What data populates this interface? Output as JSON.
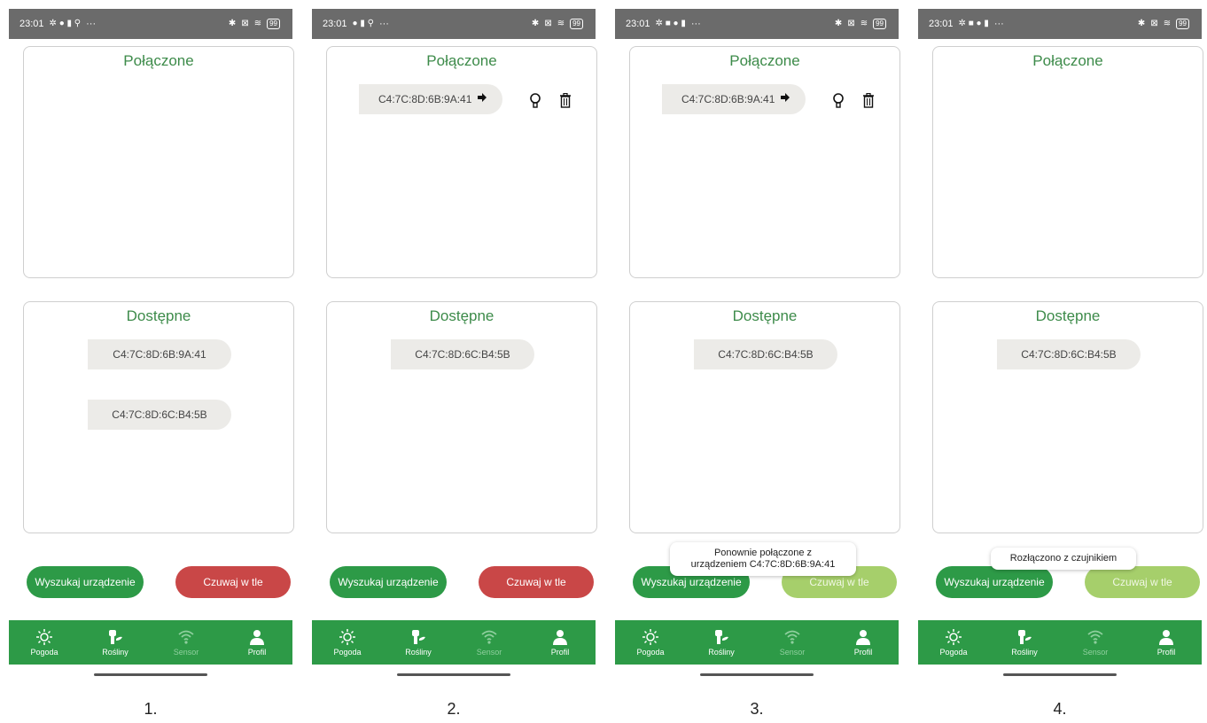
{
  "status_time": "23:01",
  "status_more": "···",
  "battery": "99",
  "section_connected": "Połączone",
  "section_available": "Dostępne",
  "device_a": "C4:7C:8D:6B:9A:41",
  "device_b": "C4:7C:8D:6C:B4:5B",
  "buttons": {
    "search": "Wyszukaj urządzenie",
    "watch": "Czuwaj w tle"
  },
  "toasts": {
    "reconnected_line1": "Ponownie połączone z",
    "reconnected_line2": "urządzeniem C4:7C:8D:6B:9A:41",
    "disconnected": "Rozłączono z czujnikiem"
  },
  "nav": {
    "weather": "Pogoda",
    "plants": "Rośliny",
    "sensor": "Sensor",
    "profile": "Profil"
  },
  "steps": [
    "1.",
    "2.",
    "3.",
    "4."
  ],
  "colors": {
    "green": "#2d9a47",
    "red": "#c94747",
    "faded_green": "#a6cf6b",
    "title_green": "#3d8b4a"
  }
}
